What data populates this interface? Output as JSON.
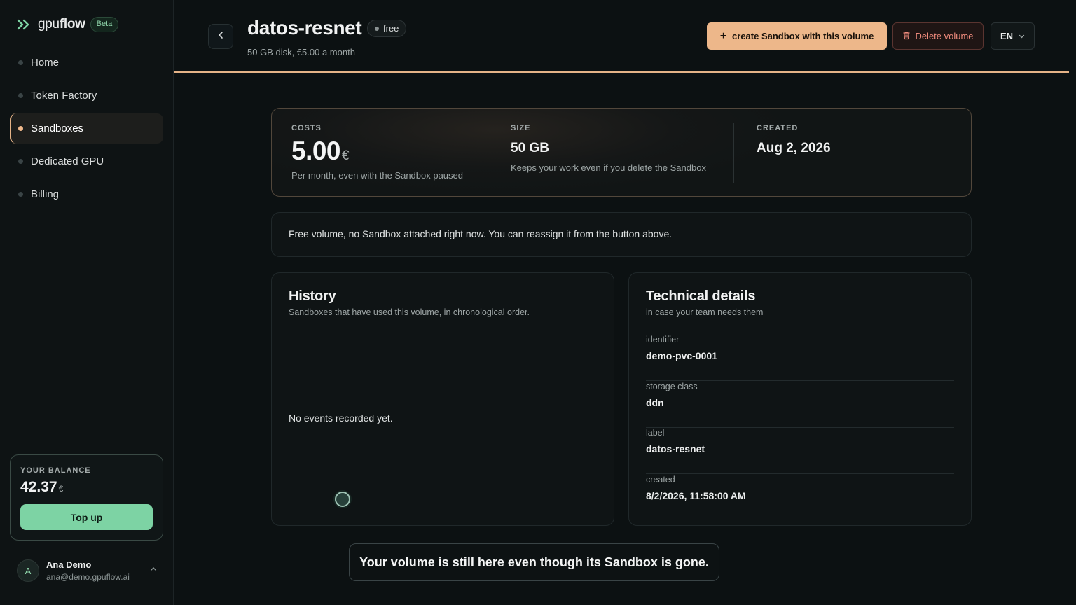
{
  "app": {
    "logo_text_light": "gpu",
    "logo_text_bold": "flow",
    "beta_label": "Beta"
  },
  "sidebar": {
    "items": [
      {
        "label": "Home",
        "active": false
      },
      {
        "label": "Token Factory",
        "active": false
      },
      {
        "label": "Sandboxes",
        "active": true
      },
      {
        "label": "Dedicated GPU",
        "active": false
      },
      {
        "label": "Billing",
        "active": false
      }
    ],
    "balance": {
      "label": "YOUR BALANCE",
      "amount": "42.37",
      "currency": "€",
      "topup_label": "Top up"
    },
    "user": {
      "initial": "A",
      "name": "Ana Demo",
      "email": "ana@demo.gpuflow.ai"
    }
  },
  "header": {
    "title": "datos-resnet",
    "status_badge": "free",
    "subtitle": "50 GB disk, €5.00 a month",
    "create_label": "create Sandbox with this volume",
    "delete_label": "Delete volume",
    "language": "EN"
  },
  "stats": {
    "costs": {
      "label": "COSTS",
      "value": "5.00",
      "currency": "€",
      "note": "Per month, even with the Sandbox paused"
    },
    "size": {
      "label": "SIZE",
      "value": "50 GB",
      "note": "Keeps your work even if you delete the Sandbox"
    },
    "created": {
      "label": "CREATED",
      "value": "Aug 2, 2026"
    }
  },
  "notice": "Free volume, no Sandbox attached right now. You can reassign it from the button above.",
  "history": {
    "title": "History",
    "subtitle": "Sandboxes that have used this volume, in chronological order.",
    "empty": "No events recorded yet."
  },
  "technical": {
    "title": "Technical details",
    "subtitle": "in case your team needs them",
    "rows": [
      {
        "key": "identifier",
        "value": "demo-pvc-0001"
      },
      {
        "key": "storage class",
        "value": "ddn"
      },
      {
        "key": "label",
        "value": "datos-resnet"
      },
      {
        "key": "created",
        "value": "8/2/2026, 11:58:00 AM"
      }
    ]
  },
  "toast": "Your volume is still here even though its Sandbox is gone.",
  "colors": {
    "accent": "#edb78a",
    "success": "#7dd3a4",
    "danger": "#f08b7d",
    "background": "#0c1112"
  }
}
